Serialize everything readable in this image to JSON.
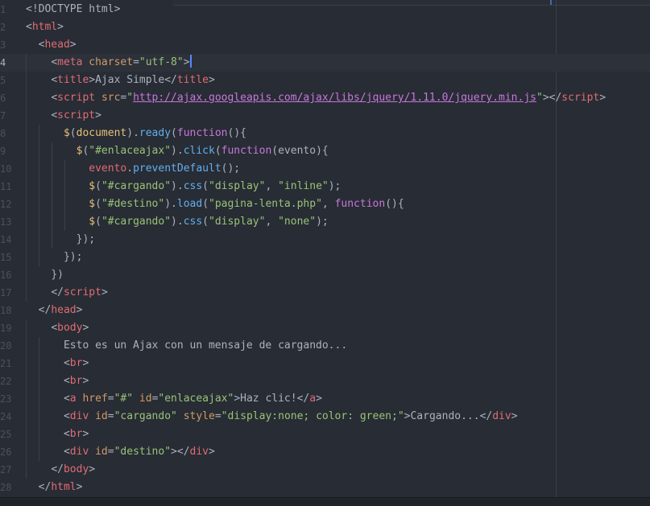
{
  "editor": {
    "lines": [
      {
        "ln": "1",
        "active": false,
        "tokens": [
          [
            "sym",
            "<!DOCTYPE html>"
          ]
        ]
      },
      {
        "ln": "2",
        "active": false,
        "tokens": [
          [
            "sym",
            "<"
          ],
          [
            "tag",
            "html"
          ],
          [
            "sym",
            ">"
          ]
        ]
      },
      {
        "ln": "3",
        "active": false,
        "tokens": [
          [
            "plain",
            "  "
          ],
          [
            "sym",
            "<"
          ],
          [
            "tag",
            "head"
          ],
          [
            "sym",
            ">"
          ]
        ]
      },
      {
        "ln": "4",
        "active": true,
        "tokens": [
          [
            "plain",
            "    "
          ],
          [
            "sym",
            "<"
          ],
          [
            "tag",
            "meta"
          ],
          [
            "plain",
            " "
          ],
          [
            "attr",
            "charset"
          ],
          [
            "sym",
            "="
          ],
          [
            "str",
            "\"utf-8\""
          ],
          [
            "sym",
            ">"
          ]
        ],
        "caret_after": true
      },
      {
        "ln": "5",
        "active": false,
        "tokens": [
          [
            "plain",
            "    "
          ],
          [
            "sym",
            "<"
          ],
          [
            "tag",
            "title"
          ],
          [
            "sym",
            ">"
          ],
          [
            "plain",
            "Ajax Simple"
          ],
          [
            "sym",
            "</"
          ],
          [
            "tag",
            "title"
          ],
          [
            "sym",
            ">"
          ]
        ]
      },
      {
        "ln": "6",
        "active": false,
        "tokens": [
          [
            "plain",
            "    "
          ],
          [
            "sym",
            "<"
          ],
          [
            "tag",
            "script"
          ],
          [
            "plain",
            " "
          ],
          [
            "attr",
            "src"
          ],
          [
            "sym",
            "="
          ],
          [
            "str",
            "\""
          ],
          [
            "url",
            "http://ajax.googleapis.com/ajax/libs/jquery/1.11.0/jquery.min.js"
          ],
          [
            "str",
            "\""
          ],
          [
            "sym",
            "></"
          ],
          [
            "tag",
            "script"
          ],
          [
            "sym",
            ">"
          ]
        ]
      },
      {
        "ln": "7",
        "active": false,
        "tokens": [
          [
            "plain",
            "    "
          ],
          [
            "sym",
            "<"
          ],
          [
            "tag",
            "script"
          ],
          [
            "sym",
            ">"
          ]
        ]
      },
      {
        "ln": "8",
        "active": false,
        "tokens": [
          [
            "plain",
            "      "
          ],
          [
            "obj",
            "$"
          ],
          [
            "sym",
            "("
          ],
          [
            "obj",
            "document"
          ],
          [
            "sym",
            ")."
          ],
          [
            "fn",
            "ready"
          ],
          [
            "sym",
            "("
          ],
          [
            "kw",
            "function"
          ],
          [
            "sym",
            "(){"
          ]
        ]
      },
      {
        "ln": "9",
        "active": false,
        "tokens": [
          [
            "plain",
            "        "
          ],
          [
            "obj",
            "$"
          ],
          [
            "sym",
            "("
          ],
          [
            "str",
            "\"#enlaceajax\""
          ],
          [
            "sym",
            ")."
          ],
          [
            "fn",
            "click"
          ],
          [
            "sym",
            "("
          ],
          [
            "kw",
            "function"
          ],
          [
            "sym",
            "("
          ],
          [
            "plain",
            "evento"
          ],
          [
            "sym",
            "){"
          ]
        ]
      },
      {
        "ln": "10",
        "active": false,
        "tokens": [
          [
            "plain",
            "          "
          ],
          [
            "var",
            "evento"
          ],
          [
            "sym",
            "."
          ],
          [
            "fn",
            "preventDefault"
          ],
          [
            "sym",
            "();"
          ]
        ]
      },
      {
        "ln": "11",
        "active": false,
        "tokens": [
          [
            "plain",
            "          "
          ],
          [
            "obj",
            "$"
          ],
          [
            "sym",
            "("
          ],
          [
            "str",
            "\"#cargando\""
          ],
          [
            "sym",
            ")."
          ],
          [
            "fn",
            "css"
          ],
          [
            "sym",
            "("
          ],
          [
            "str",
            "\"display\""
          ],
          [
            "sym",
            ", "
          ],
          [
            "str",
            "\"inline\""
          ],
          [
            "sym",
            ");"
          ]
        ]
      },
      {
        "ln": "12",
        "active": false,
        "tokens": [
          [
            "plain",
            "          "
          ],
          [
            "obj",
            "$"
          ],
          [
            "sym",
            "("
          ],
          [
            "str",
            "\"#destino\""
          ],
          [
            "sym",
            ")."
          ],
          [
            "fn",
            "load"
          ],
          [
            "sym",
            "("
          ],
          [
            "str",
            "\"pagina-lenta.php\""
          ],
          [
            "sym",
            ", "
          ],
          [
            "kw",
            "function"
          ],
          [
            "sym",
            "(){"
          ]
        ]
      },
      {
        "ln": "13",
        "active": false,
        "tokens": [
          [
            "plain",
            "          "
          ],
          [
            "obj",
            "$"
          ],
          [
            "sym",
            "("
          ],
          [
            "str",
            "\"#cargando\""
          ],
          [
            "sym",
            ")."
          ],
          [
            "fn",
            "css"
          ],
          [
            "sym",
            "("
          ],
          [
            "str",
            "\"display\""
          ],
          [
            "sym",
            ", "
          ],
          [
            "str",
            "\"none\""
          ],
          [
            "sym",
            ");"
          ]
        ]
      },
      {
        "ln": "14",
        "active": false,
        "tokens": [
          [
            "plain",
            "        "
          ],
          [
            "sym",
            "});"
          ]
        ]
      },
      {
        "ln": "15",
        "active": false,
        "tokens": [
          [
            "plain",
            "      "
          ],
          [
            "sym",
            "});"
          ]
        ]
      },
      {
        "ln": "16",
        "active": false,
        "tokens": [
          [
            "plain",
            "    "
          ],
          [
            "sym",
            "})"
          ]
        ]
      },
      {
        "ln": "17",
        "active": false,
        "tokens": [
          [
            "plain",
            "    "
          ],
          [
            "sym",
            "</"
          ],
          [
            "tag",
            "script"
          ],
          [
            "sym",
            ">"
          ]
        ]
      },
      {
        "ln": "18",
        "active": false,
        "tokens": [
          [
            "plain",
            "  "
          ],
          [
            "sym",
            "</"
          ],
          [
            "tag",
            "head"
          ],
          [
            "sym",
            ">"
          ]
        ]
      },
      {
        "ln": "19",
        "active": false,
        "tokens": [
          [
            "plain",
            "    "
          ],
          [
            "sym",
            "<"
          ],
          [
            "tag",
            "body"
          ],
          [
            "sym",
            ">"
          ]
        ]
      },
      {
        "ln": "20",
        "active": false,
        "tokens": [
          [
            "plain",
            "      Esto es un Ajax con un mensaje de cargando..."
          ]
        ]
      },
      {
        "ln": "21",
        "active": false,
        "tokens": [
          [
            "plain",
            "      "
          ],
          [
            "sym",
            "<"
          ],
          [
            "tag",
            "br"
          ],
          [
            "sym",
            ">"
          ]
        ]
      },
      {
        "ln": "22",
        "active": false,
        "tokens": [
          [
            "plain",
            "      "
          ],
          [
            "sym",
            "<"
          ],
          [
            "tag",
            "br"
          ],
          [
            "sym",
            ">"
          ]
        ]
      },
      {
        "ln": "23",
        "active": false,
        "tokens": [
          [
            "plain",
            "      "
          ],
          [
            "sym",
            "<"
          ],
          [
            "tag",
            "a"
          ],
          [
            "plain",
            " "
          ],
          [
            "attr",
            "href"
          ],
          [
            "sym",
            "="
          ],
          [
            "str",
            "\"#\""
          ],
          [
            "plain",
            " "
          ],
          [
            "attr",
            "id"
          ],
          [
            "sym",
            "="
          ],
          [
            "str",
            "\"enlaceajax\""
          ],
          [
            "sym",
            ">"
          ],
          [
            "plain",
            "Haz clic!"
          ],
          [
            "sym",
            "</"
          ],
          [
            "tag",
            "a"
          ],
          [
            "sym",
            ">"
          ]
        ]
      },
      {
        "ln": "24",
        "active": false,
        "tokens": [
          [
            "plain",
            "      "
          ],
          [
            "sym",
            "<"
          ],
          [
            "tag",
            "div"
          ],
          [
            "plain",
            " "
          ],
          [
            "attr",
            "id"
          ],
          [
            "sym",
            "="
          ],
          [
            "str",
            "\"cargando\""
          ],
          [
            "plain",
            " "
          ],
          [
            "attr",
            "style"
          ],
          [
            "sym",
            "="
          ],
          [
            "str",
            "\"display:none; color: green;\""
          ],
          [
            "sym",
            ">"
          ],
          [
            "plain",
            "Cargando..."
          ],
          [
            "sym",
            "</"
          ],
          [
            "tag",
            "div"
          ],
          [
            "sym",
            ">"
          ]
        ]
      },
      {
        "ln": "25",
        "active": false,
        "tokens": [
          [
            "plain",
            "      "
          ],
          [
            "sym",
            "<"
          ],
          [
            "tag",
            "br"
          ],
          [
            "sym",
            ">"
          ]
        ]
      },
      {
        "ln": "26",
        "active": false,
        "tokens": [
          [
            "plain",
            "      "
          ],
          [
            "sym",
            "<"
          ],
          [
            "tag",
            "div"
          ],
          [
            "plain",
            " "
          ],
          [
            "attr",
            "id"
          ],
          [
            "sym",
            "="
          ],
          [
            "str",
            "\"destino\""
          ],
          [
            "sym",
            "></"
          ],
          [
            "tag",
            "div"
          ],
          [
            "sym",
            ">"
          ]
        ]
      },
      {
        "ln": "27",
        "active": false,
        "tokens": [
          [
            "plain",
            "    "
          ],
          [
            "sym",
            "</"
          ],
          [
            "tag",
            "body"
          ],
          [
            "sym",
            ">"
          ]
        ]
      },
      {
        "ln": "28",
        "active": false,
        "tokens": [
          [
            "plain",
            "  "
          ],
          [
            "sym",
            "</"
          ],
          [
            "tag",
            "html"
          ],
          [
            "sym",
            ">"
          ]
        ]
      }
    ]
  }
}
